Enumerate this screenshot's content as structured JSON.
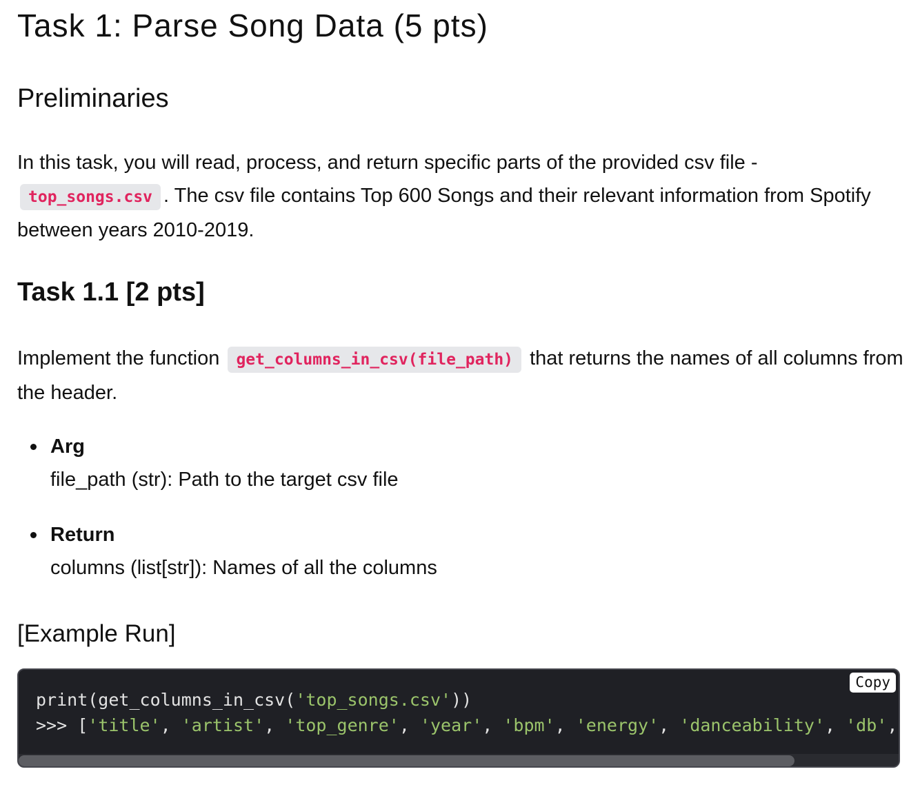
{
  "title": "Task 1: Parse Song Data (5 pts)",
  "preliminaries": {
    "heading": "Preliminaries",
    "text_before": "In this task, you will read, process, and return specific parts of the provided csv file -",
    "code": "top_songs.csv",
    "text_after": ". The csv file contains Top 600 Songs and their relevant information from Spotify between years 2010-2019."
  },
  "task11": {
    "heading": "Task 1.1 [2 pts]",
    "text_before": "Implement the function",
    "code": "get_columns_in_csv(file_path)",
    "text_after": "that returns the names of all columns from the header.",
    "items": [
      {
        "label": "Arg",
        "desc": "file_path (str): Path to the target csv file"
      },
      {
        "label": "Return",
        "desc": "columns (list[str]): Names of all the columns"
      }
    ]
  },
  "example": {
    "heading": "[Example Run]",
    "copy_label": "Copy",
    "line1": {
      "pre": "print(get_columns_in_csv(",
      "str": "'top_songs.csv'",
      "post": "))"
    },
    "line2": {
      "prompt": ">>> [",
      "strings": [
        "'title'",
        "'artist'",
        "'top_genre'",
        "'year'",
        "'bpm'",
        "'energy'",
        "'danceability'",
        "'db'"
      ],
      "separator": ", "
    }
  }
}
